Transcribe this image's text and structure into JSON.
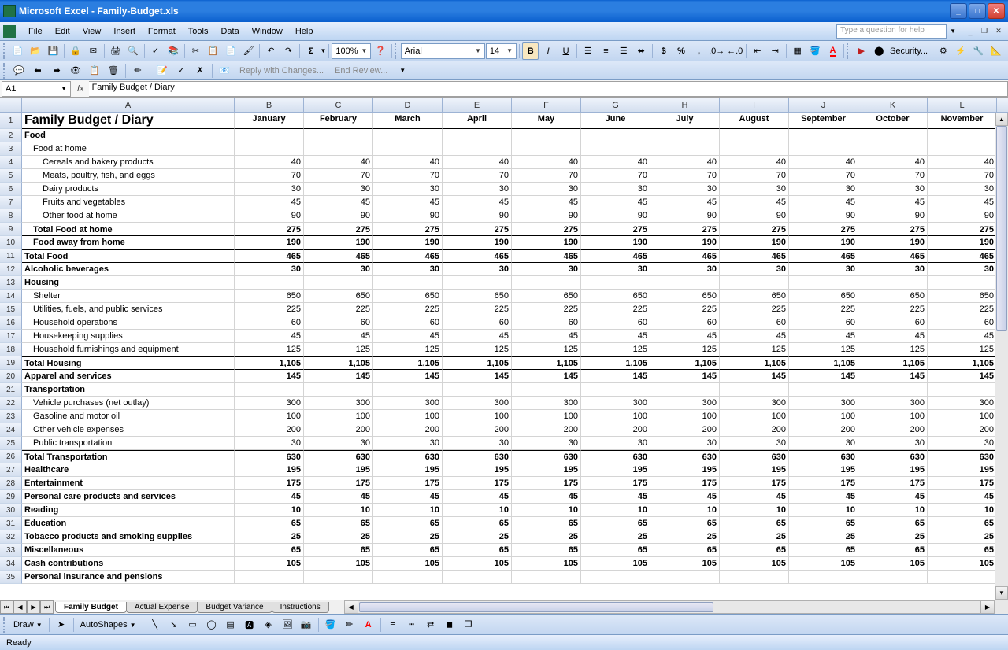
{
  "app": {
    "title": "Microsoft Excel - Family-Budget.xls"
  },
  "menu": [
    "File",
    "Edit",
    "View",
    "Insert",
    "Format",
    "Tools",
    "Data",
    "Window",
    "Help"
  ],
  "help_placeholder": "Type a question for help",
  "toolbar": {
    "zoom": "100%",
    "font": "Arial",
    "size": "14",
    "security": "Security..."
  },
  "review": {
    "reply": "Reply with Changes...",
    "end": "End Review..."
  },
  "formula": {
    "cellref": "A1",
    "fx": "fx",
    "value": "Family Budget / Diary"
  },
  "columns": [
    "A",
    "B",
    "C",
    "D",
    "E",
    "F",
    "G",
    "H",
    "I",
    "J",
    "K",
    "L"
  ],
  "months": [
    "January",
    "February",
    "March",
    "April",
    "May",
    "June",
    "July",
    "August",
    "September",
    "October",
    "November"
  ],
  "rows": [
    {
      "n": 1,
      "a": "Family Budget / Diary",
      "hdr": true,
      "title": true
    },
    {
      "n": 2,
      "a": "Food",
      "bold": true
    },
    {
      "n": 3,
      "a": "Food at home",
      "ind": 1
    },
    {
      "n": 4,
      "a": "Cereals and bakery products",
      "ind": 2,
      "v": "40"
    },
    {
      "n": 5,
      "a": "Meats, poultry, fish, and eggs",
      "ind": 2,
      "v": "70"
    },
    {
      "n": 6,
      "a": "Dairy products",
      "ind": 2,
      "v": "30"
    },
    {
      "n": 7,
      "a": "Fruits and vegetables",
      "ind": 2,
      "v": "45"
    },
    {
      "n": 8,
      "a": "Other food at home",
      "ind": 2,
      "v": "90"
    },
    {
      "n": 9,
      "a": "Total Food at home",
      "ind": 1,
      "bold": true,
      "v": "275",
      "dark": true
    },
    {
      "n": 10,
      "a": "Food away from home",
      "ind": 1,
      "bold": true,
      "v": "190"
    },
    {
      "n": 11,
      "a": "Total Food",
      "bold": true,
      "v": "465",
      "dark": true
    },
    {
      "n": 12,
      "a": "Alcoholic beverages",
      "bold": true,
      "v": "30"
    },
    {
      "n": 13,
      "a": "Housing",
      "bold": true
    },
    {
      "n": 14,
      "a": "Shelter",
      "ind": 1,
      "v": "650"
    },
    {
      "n": 15,
      "a": "Utilities, fuels, and public services",
      "ind": 1,
      "v": "225"
    },
    {
      "n": 16,
      "a": "Household operations",
      "ind": 1,
      "v": "60"
    },
    {
      "n": 17,
      "a": "Housekeeping supplies",
      "ind": 1,
      "v": "45"
    },
    {
      "n": 18,
      "a": "Household furnishings and equipment",
      "ind": 1,
      "v": "125"
    },
    {
      "n": 19,
      "a": "Total Housing",
      "bold": true,
      "v": "1,105",
      "dark": true
    },
    {
      "n": 20,
      "a": "Apparel and services",
      "bold": true,
      "v": "145"
    },
    {
      "n": 21,
      "a": "Transportation",
      "bold": true
    },
    {
      "n": 22,
      "a": "Vehicle purchases (net outlay)",
      "ind": 1,
      "v": "300"
    },
    {
      "n": 23,
      "a": "Gasoline and motor oil",
      "ind": 1,
      "v": "100"
    },
    {
      "n": 24,
      "a": "Other vehicle expenses",
      "ind": 1,
      "v": "200"
    },
    {
      "n": 25,
      "a": "Public transportation",
      "ind": 1,
      "v": "30"
    },
    {
      "n": 26,
      "a": "Total Transportation",
      "bold": true,
      "v": "630",
      "dark": true
    },
    {
      "n": 27,
      "a": "Healthcare",
      "bold": true,
      "v": "195"
    },
    {
      "n": 28,
      "a": "Entertainment",
      "bold": true,
      "v": "175"
    },
    {
      "n": 29,
      "a": "Personal care products and services",
      "bold": true,
      "v": "45"
    },
    {
      "n": 30,
      "a": "Reading",
      "bold": true,
      "v": "10"
    },
    {
      "n": 31,
      "a": "Education",
      "bold": true,
      "v": "65"
    },
    {
      "n": 32,
      "a": "Tobacco products and smoking supplies",
      "bold": true,
      "v": "25"
    },
    {
      "n": 33,
      "a": "Miscellaneous",
      "bold": true,
      "v": "65"
    },
    {
      "n": 34,
      "a": "Cash contributions",
      "bold": true,
      "v": "105"
    },
    {
      "n": 35,
      "a": "Personal insurance and pensions",
      "bold": true
    }
  ],
  "sheets": [
    "Family Budget",
    "Actual Expense",
    "Budget Variance",
    "Instructions"
  ],
  "draw": {
    "label": "Draw",
    "autoshapes": "AutoShapes"
  },
  "status": "Ready"
}
